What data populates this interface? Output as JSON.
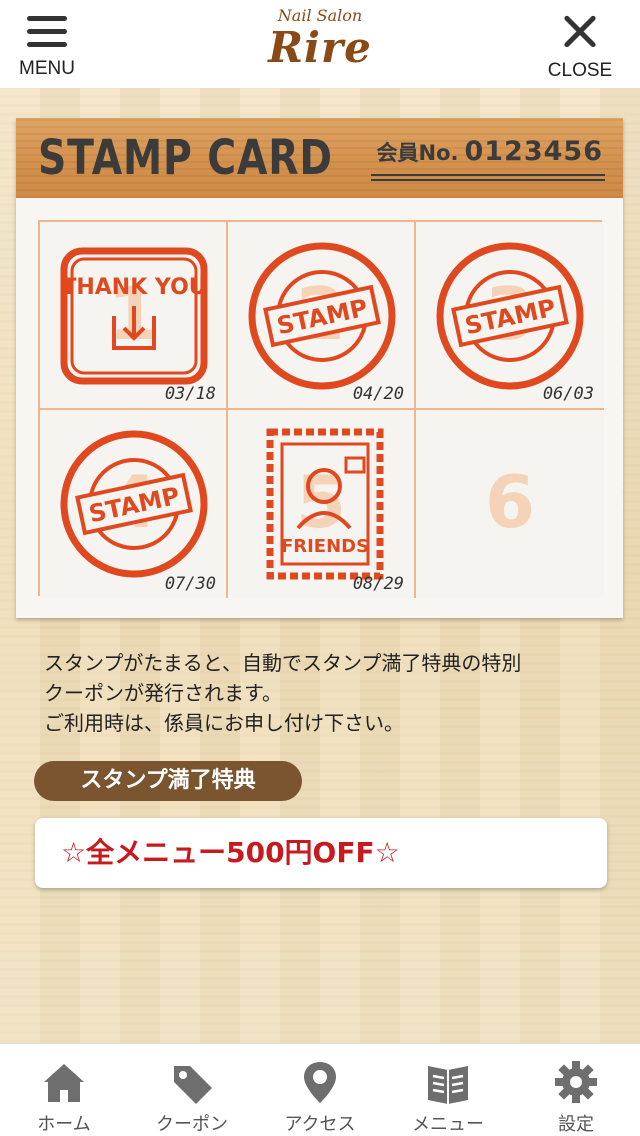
{
  "header": {
    "menu_label": "MENU",
    "close_label": "CLOSE",
    "logo_sub": "Nail Salon",
    "logo_main": "Rire"
  },
  "card": {
    "title": "STAMP CARD",
    "member_label": "会員No.",
    "member_no": "0123456",
    "cells": [
      {
        "number": "1",
        "stamp": "thank-you",
        "stamp_text": "THANK YOU",
        "date": "03/18"
      },
      {
        "number": "2",
        "stamp": "stamp",
        "stamp_text": "STAMP",
        "date": "04/20"
      },
      {
        "number": "3",
        "stamp": "stamp",
        "stamp_text": "STAMP",
        "date": "06/03"
      },
      {
        "number": "4",
        "stamp": "stamp",
        "stamp_text": "STAMP",
        "date": "07/30"
      },
      {
        "number": "5",
        "stamp": "friends",
        "stamp_text": "FRIENDS",
        "date": "08/29"
      },
      {
        "number": "6",
        "stamp": "",
        "stamp_text": "",
        "date": ""
      }
    ],
    "stamp_color": "#e0481f"
  },
  "description": {
    "line1": "スタンプがたまると、自動でスタンプ満了特典の特別",
    "line2": "クーポンが発行されます。",
    "line3": "ご利用時は、係員にお申し付け下さい。"
  },
  "reward": {
    "label": "スタンプ満了特典",
    "coupon": "☆全メニュー500円OFF☆"
  },
  "tabbar": {
    "items": [
      {
        "label": "ホーム",
        "icon": "home-icon"
      },
      {
        "label": "クーポン",
        "icon": "coupon-tag-icon"
      },
      {
        "label": "アクセス",
        "icon": "map-pin-icon"
      },
      {
        "label": "メニュー",
        "icon": "book-icon"
      },
      {
        "label": "設定",
        "icon": "gear-icon"
      }
    ]
  }
}
